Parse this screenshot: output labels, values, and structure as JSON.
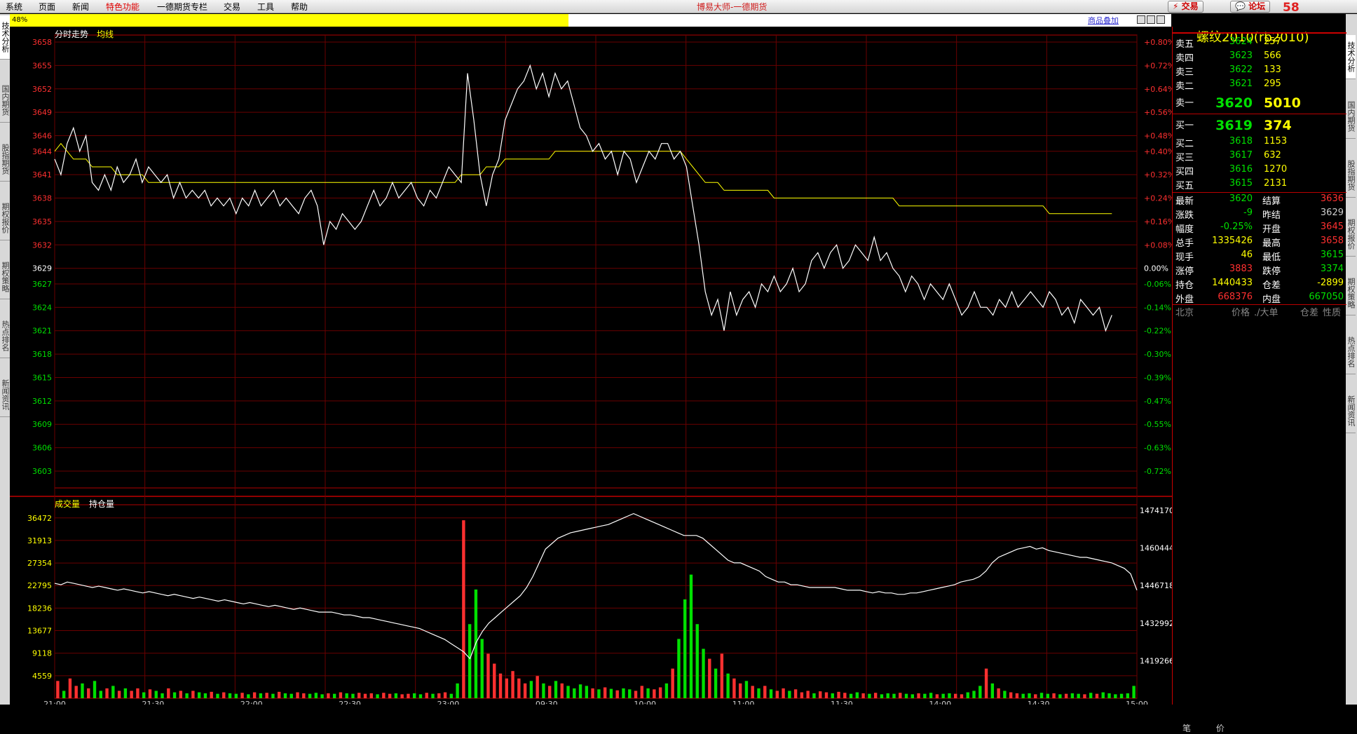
{
  "menu": {
    "items": [
      "系统",
      "页面",
      "新闻",
      "特色功能",
      "一德期货专栏",
      "交易",
      "工具",
      "帮助"
    ],
    "highlight_index": 3
  },
  "window_title": "博易大师-一德期货",
  "toolbar": {
    "trade_label": "交易",
    "forum_label": "论坛"
  },
  "logo": {
    "text": "58"
  },
  "progress": {
    "text": "48%",
    "value": 0.48
  },
  "overlay_link": "商品叠加",
  "left_tabs": [
    "技术分析",
    "国内期货",
    "股指期货",
    "期权报价",
    "期权策略",
    "热点排名",
    "新闻资讯"
  ],
  "right_tabs": [
    "技术分析",
    "国内期货",
    "股指期货",
    "期权报价",
    "期权策略",
    "热点排名",
    "新闻资讯"
  ],
  "colors": {
    "up": "#ff3030",
    "down": "#00e000",
    "price_line": "#ffffff",
    "avg_line": "#ffff00",
    "grid": "#8b0000",
    "text": "#ffff00"
  },
  "chart_data": [
    {
      "type": "line",
      "title": "分时走势",
      "legend": [
        "均线"
      ],
      "y_ticks": [
        3658,
        3655,
        3652,
        3649,
        3646,
        3644,
        3641,
        3638,
        3635,
        3632,
        3629,
        3627,
        3624,
        3621,
        3618,
        3615,
        3612,
        3609,
        3606,
        3603
      ],
      "pct_ticks": [
        "+0.80%",
        "+0.72%",
        "+0.64%",
        "+0.56%",
        "+0.48%",
        "+0.40%",
        "+0.32%",
        "+0.24%",
        "+0.16%",
        "+0.08%",
        "0.00%",
        "-0.06%",
        "-0.14%",
        "-0.22%",
        "-0.30%",
        "-0.39%",
        "-0.47%",
        "-0.55%",
        "-0.63%",
        "-0.72%"
      ],
      "ylim": [
        3603,
        3658
      ],
      "x": [
        0,
        2,
        4,
        6,
        8,
        10,
        12,
        14,
        16,
        18,
        20,
        22,
        24,
        26,
        28,
        30,
        32,
        34,
        36,
        38,
        40,
        42,
        44,
        46,
        48,
        50,
        52,
        54,
        56,
        58,
        60,
        62,
        64,
        66,
        68,
        70,
        72,
        74,
        76,
        78,
        80,
        82,
        84,
        86,
        88,
        90,
        92,
        94,
        96,
        98,
        100,
        102,
        104,
        106,
        108,
        110,
        112,
        114,
        116,
        118,
        120,
        122,
        124,
        126,
        128,
        130,
        132,
        134,
        136,
        138,
        140,
        142,
        144,
        146,
        148,
        150,
        152,
        154,
        156,
        158,
        160,
        162,
        164,
        166,
        168,
        170,
        172,
        174,
        176,
        178,
        180,
        182,
        184,
        186,
        188,
        190,
        192,
        194,
        196,
        198,
        200,
        202,
        204,
        206,
        208,
        210,
        212,
        214,
        216,
        218,
        220,
        222,
        224,
        226,
        228,
        230,
        232,
        234,
        236,
        238,
        240,
        242,
        244,
        246,
        248,
        250,
        252,
        254,
        256,
        258,
        260,
        262,
        264,
        266,
        268,
        270,
        272,
        274,
        276,
        278,
        280,
        282,
        284,
        286,
        288,
        290,
        292,
        294,
        296,
        298,
        300,
        302,
        304,
        306,
        308,
        310,
        312,
        314,
        316,
        318,
        320,
        322,
        324,
        326,
        328,
        330,
        332,
        334,
        336,
        338,
        340,
        342,
        344,
        346
      ],
      "price": [
        3643,
        3641,
        3645,
        3647,
        3644,
        3646,
        3640,
        3639,
        3641,
        3639,
        3642,
        3640,
        3641,
        3643,
        3640,
        3642,
        3641,
        3640,
        3641,
        3638,
        3640,
        3638,
        3639,
        3638,
        3639,
        3637,
        3638,
        3637,
        3638,
        3636,
        3638,
        3637,
        3639,
        3637,
        3638,
        3639,
        3637,
        3638,
        3637,
        3636,
        3638,
        3639,
        3637,
        3632,
        3635,
        3634,
        3636,
        3635,
        3634,
        3635,
        3637,
        3639,
        3637,
        3638,
        3640,
        3638,
        3639,
        3640,
        3638,
        3637,
        3639,
        3638,
        3640,
        3642,
        3641,
        3640,
        3654,
        3648,
        3641,
        3637,
        3641,
        3643,
        3648,
        3650,
        3652,
        3653,
        3655,
        3652,
        3654,
        3651,
        3654,
        3652,
        3653,
        3650,
        3647,
        3646,
        3644,
        3645,
        3643,
        3644,
        3641,
        3644,
        3643,
        3640,
        3642,
        3644,
        3643,
        3645,
        3645,
        3643,
        3644,
        3642,
        3637,
        3632,
        3626,
        3623,
        3625,
        3621,
        3626,
        3623,
        3625,
        3626,
        3624,
        3627,
        3626,
        3628,
        3626,
        3627,
        3629,
        3626,
        3627,
        3630,
        3631,
        3629,
        3631,
        3632,
        3629,
        3630,
        3632,
        3631,
        3630,
        3633,
        3630,
        3631,
        3629,
        3628,
        3626,
        3628,
        3627,
        3625,
        3627,
        3626,
        3625,
        3627,
        3625,
        3623,
        3624,
        3626,
        3624,
        3624,
        3623,
        3625,
        3624,
        3626,
        3624,
        3625,
        3626,
        3625,
        3624,
        3626,
        3625,
        3623,
        3624,
        3622,
        3625,
        3624,
        3623,
        3624,
        3621,
        3623
      ],
      "avg": [
        3644,
        3645,
        3644,
        3643,
        3643,
        3643,
        3642,
        3642,
        3642,
        3642,
        3641,
        3641,
        3641,
        3641,
        3641,
        3640,
        3640,
        3640,
        3640,
        3640,
        3640,
        3640,
        3640,
        3640,
        3640,
        3640,
        3640,
        3640,
        3640,
        3640,
        3640,
        3640,
        3640,
        3640,
        3640,
        3640,
        3640,
        3640,
        3640,
        3640,
        3640,
        3640,
        3640,
        3640,
        3640,
        3640,
        3640,
        3640,
        3640,
        3640,
        3640,
        3640,
        3640,
        3640,
        3640,
        3640,
        3640,
        3640,
        3640,
        3640,
        3640,
        3640,
        3640,
        3640,
        3640,
        3641,
        3641,
        3641,
        3641,
        3642,
        3642,
        3642,
        3643,
        3643,
        3643,
        3643,
        3643,
        3643,
        3643,
        3643,
        3644,
        3644,
        3644,
        3644,
        3644,
        3644,
        3644,
        3644,
        3644,
        3644,
        3644,
        3644,
        3644,
        3644,
        3644,
        3644,
        3644,
        3644,
        3644,
        3644,
        3644,
        3643,
        3642,
        3641,
        3640,
        3640,
        3640,
        3639,
        3639,
        3639,
        3639,
        3639,
        3639,
        3639,
        3639,
        3638,
        3638,
        3638,
        3638,
        3638,
        3638,
        3638,
        3638,
        3638,
        3638,
        3638,
        3638,
        3638,
        3638,
        3638,
        3638,
        3638,
        3638,
        3638,
        3638,
        3637,
        3637,
        3637,
        3637,
        3637,
        3637,
        3637,
        3637,
        3637,
        3637,
        3637,
        3637,
        3637,
        3637,
        3637,
        3637,
        3637,
        3637,
        3637,
        3637,
        3637,
        3637,
        3637,
        3637,
        3636,
        3636,
        3636,
        3636,
        3636,
        3636,
        3636,
        3636,
        3636,
        3636,
        3636
      ]
    },
    {
      "type": "bar",
      "title": "成交量",
      "legend": [
        "持仓量"
      ],
      "y_ticks": [
        36472,
        31913,
        27354,
        22795,
        18236,
        13677,
        9118,
        4559
      ],
      "oi_ticks": [
        1474170,
        1460444,
        1446718,
        1432992,
        1419266
      ],
      "ylim": [
        0,
        38000
      ],
      "oi_lim": [
        1405540,
        1474170
      ],
      "x_ticks": [
        "21:00",
        "21:30",
        "22:00",
        "22:30",
        "23:00",
        "09:30",
        "10:00",
        "11:00",
        "11:30",
        "14:00",
        "14:30",
        "15:00"
      ],
      "volume": [
        3500,
        1500,
        4000,
        2500,
        3000,
        2000,
        3500,
        1500,
        2000,
        2500,
        1500,
        2000,
        1500,
        2000,
        1200,
        1800,
        1500,
        1000,
        2000,
        1200,
        1500,
        1000,
        1500,
        1200,
        1000,
        1300,
        900,
        1200,
        1000,
        900,
        1100,
        800,
        1200,
        1000,
        1100,
        900,
        1300,
        1000,
        900,
        1200,
        1000,
        900,
        1100,
        800,
        1000,
        900,
        1200,
        1000,
        900,
        1100,
        900,
        1000,
        800,
        1100,
        900,
        1000,
        800,
        900,
        1000,
        800,
        1100,
        900,
        1000,
        1200,
        900,
        3000,
        36000,
        15000,
        22000,
        12000,
        9000,
        7000,
        5000,
        4000,
        5500,
        4000,
        3000,
        3500,
        4500,
        3000,
        2500,
        3500,
        3000,
        2500,
        2000,
        2800,
        2500,
        2000,
        1800,
        2200,
        1900,
        1600,
        2000,
        1800,
        1500,
        2500,
        2000,
        1800,
        2200,
        3000,
        6000,
        12000,
        20000,
        25000,
        15000,
        10000,
        8000,
        6000,
        9000,
        5000,
        4000,
        3000,
        3500,
        2500,
        2000,
        2500,
        1800,
        1500,
        2000,
        1500,
        1800,
        1200,
        1500,
        1000,
        1400,
        1200,
        1000,
        1300,
        1100,
        900,
        1200,
        1000,
        900,
        1100,
        800,
        1000,
        900,
        1100,
        900,
        800,
        1000,
        900,
        1100,
        800,
        900,
        1000,
        900,
        800,
        1200,
        1500,
        2500,
        6000,
        3000,
        2000,
        1500,
        1200,
        1000,
        900,
        1000,
        800,
        1100,
        900,
        1000,
        800,
        900,
        1000,
        900,
        800,
        1100,
        900,
        1200,
        1000,
        800,
        900,
        1000,
        2500
      ],
      "vol_up": [
        1,
        0,
        1,
        1,
        0,
        1,
        0,
        0,
        1,
        0,
        1,
        0,
        1,
        1,
        0,
        1,
        0,
        0,
        1,
        0,
        1,
        0,
        1,
        0,
        0,
        1,
        0,
        1,
        0,
        0,
        1,
        0,
        1,
        0,
        1,
        0,
        1,
        0,
        0,
        1,
        1,
        0,
        0,
        0,
        1,
        0,
        1,
        0,
        0,
        1,
        1,
        1,
        0,
        1,
        1,
        0,
        1,
        1,
        0,
        0,
        1,
        0,
        1,
        1,
        0,
        0,
        1,
        0,
        0,
        0,
        1,
        1,
        1,
        1,
        1,
        1,
        1,
        0,
        1,
        0,
        1,
        0,
        1,
        0,
        0,
        0,
        0,
        1,
        0,
        1,
        0,
        1,
        0,
        0,
        1,
        1,
        0,
        1,
        1,
        0,
        1,
        0,
        0,
        0,
        0,
        0,
        1,
        0,
        1,
        0,
        1,
        1,
        0,
        1,
        0,
        1,
        0,
        1,
        1,
        0,
        1,
        1,
        1,
        0,
        1,
        1,
        0,
        1,
        1,
        0,
        0,
        1,
        0,
        1,
        0,
        0,
        0,
        1,
        0,
        0,
        1,
        0,
        0,
        1,
        0,
        0,
        1,
        1,
        0,
        0,
        0,
        1,
        0,
        1,
        0,
        1,
        1,
        0,
        0,
        1,
        0,
        0,
        1,
        0,
        1,
        0,
        0,
        1,
        0,
        1
      ],
      "open_interest": [
        1447500,
        1447000,
        1448000,
        1447500,
        1447000,
        1446500,
        1446000,
        1446500,
        1446000,
        1445500,
        1445000,
        1445500,
        1445000,
        1444500,
        1444000,
        1444500,
        1444000,
        1443500,
        1443000,
        1443500,
        1443000,
        1442500,
        1442000,
        1442500,
        1442000,
        1441500,
        1441000,
        1441500,
        1441000,
        1440500,
        1440000,
        1440500,
        1440000,
        1439500,
        1439000,
        1439500,
        1439000,
        1438500,
        1438000,
        1438500,
        1438000,
        1437500,
        1437000,
        1437000,
        1437000,
        1436500,
        1436000,
        1436000,
        1435500,
        1435000,
        1435000,
        1434500,
        1434000,
        1433500,
        1433000,
        1432500,
        1432000,
        1431500,
        1431000,
        1430000,
        1429000,
        1428000,
        1427000,
        1425500,
        1424000,
        1422500,
        1420000,
        1426000,
        1430000,
        1433000,
        1435000,
        1437000,
        1439000,
        1441000,
        1443000,
        1446000,
        1450000,
        1455000,
        1460000,
        1462000,
        1464000,
        1465000,
        1466000,
        1466500,
        1467000,
        1467500,
        1468000,
        1468500,
        1469000,
        1470000,
        1471000,
        1472000,
        1473000,
        1472000,
        1471000,
        1470000,
        1469000,
        1468000,
        1467000,
        1466000,
        1465000,
        1465000,
        1465000,
        1464000,
        1462000,
        1460000,
        1458000,
        1456000,
        1455000,
        1455000,
        1454000,
        1453000,
        1452000,
        1450000,
        1449000,
        1448000,
        1448000,
        1447000,
        1447000,
        1446500,
        1446000,
        1446000,
        1446000,
        1446000,
        1446000,
        1445500,
        1445000,
        1445000,
        1445000,
        1444500,
        1444000,
        1444500,
        1444000,
        1444000,
        1443500,
        1443500,
        1444000,
        1444000,
        1444500,
        1445000,
        1445500,
        1446000,
        1446500,
        1447000,
        1448000,
        1448500,
        1449000,
        1450000,
        1452000,
        1455000,
        1457000,
        1458000,
        1459000,
        1460000,
        1460500,
        1461000,
        1460000,
        1460500,
        1459500,
        1459000,
        1458500,
        1458000,
        1457500,
        1457000,
        1457000,
        1456500,
        1456000,
        1455500,
        1455000,
        1454000,
        1453000,
        1451000,
        1445000
      ]
    }
  ],
  "quote": {
    "title": "螺纹2010(rb2010)",
    "asks": [
      {
        "label": "卖五",
        "price": "3624",
        "vol": "257"
      },
      {
        "label": "卖四",
        "price": "3623",
        "vol": "566"
      },
      {
        "label": "卖三",
        "price": "3622",
        "vol": "133"
      },
      {
        "label": "卖二",
        "price": "3621",
        "vol": "295"
      },
      {
        "label": "卖一",
        "price": "3620",
        "vol": "5010"
      }
    ],
    "bids": [
      {
        "label": "买一",
        "price": "3619",
        "vol": "374"
      },
      {
        "label": "买二",
        "price": "3618",
        "vol": "1153"
      },
      {
        "label": "买三",
        "price": "3617",
        "vol": "632"
      },
      {
        "label": "买四",
        "price": "3616",
        "vol": "1270"
      },
      {
        "label": "买五",
        "price": "3615",
        "vol": "2131"
      }
    ],
    "stats": [
      {
        "l1": "最新",
        "v1": "3620",
        "c1": "green",
        "l2": "结算",
        "v2": "3636",
        "c2": "red"
      },
      {
        "l1": "涨跌",
        "v1": "-9",
        "c1": "green",
        "l2": "昨结",
        "v2": "3629",
        "c2": "white"
      },
      {
        "l1": "幅度",
        "v1": "-0.25%",
        "c1": "green",
        "l2": "开盘",
        "v2": "3645",
        "c2": "red"
      },
      {
        "l1": "总手",
        "v1": "1335426",
        "c1": "yellow",
        "l2": "最高",
        "v2": "3658",
        "c2": "red"
      },
      {
        "l1": "现手",
        "v1": "46",
        "c1": "yellow",
        "l2": "最低",
        "v2": "3615",
        "c2": "green"
      },
      {
        "l1": "涨停",
        "v1": "3883",
        "c1": "red",
        "l2": "跌停",
        "v2": "3374",
        "c2": "green"
      },
      {
        "l1": "持仓",
        "v1": "1440433",
        "c1": "yellow",
        "l2": "仓差",
        "v2": "-2899",
        "c2": "yellow"
      },
      {
        "l1": "外盘",
        "v1": "668376",
        "c1": "red",
        "l2": "内盘",
        "v2": "667050",
        "c2": "green"
      }
    ],
    "tick_header": {
      "c1": "北京",
      "c2": "价格",
      "c3": "./大单",
      "c4": "仓差",
      "c5": "性质"
    },
    "bottom_tabs": [
      "笔",
      "价"
    ]
  }
}
